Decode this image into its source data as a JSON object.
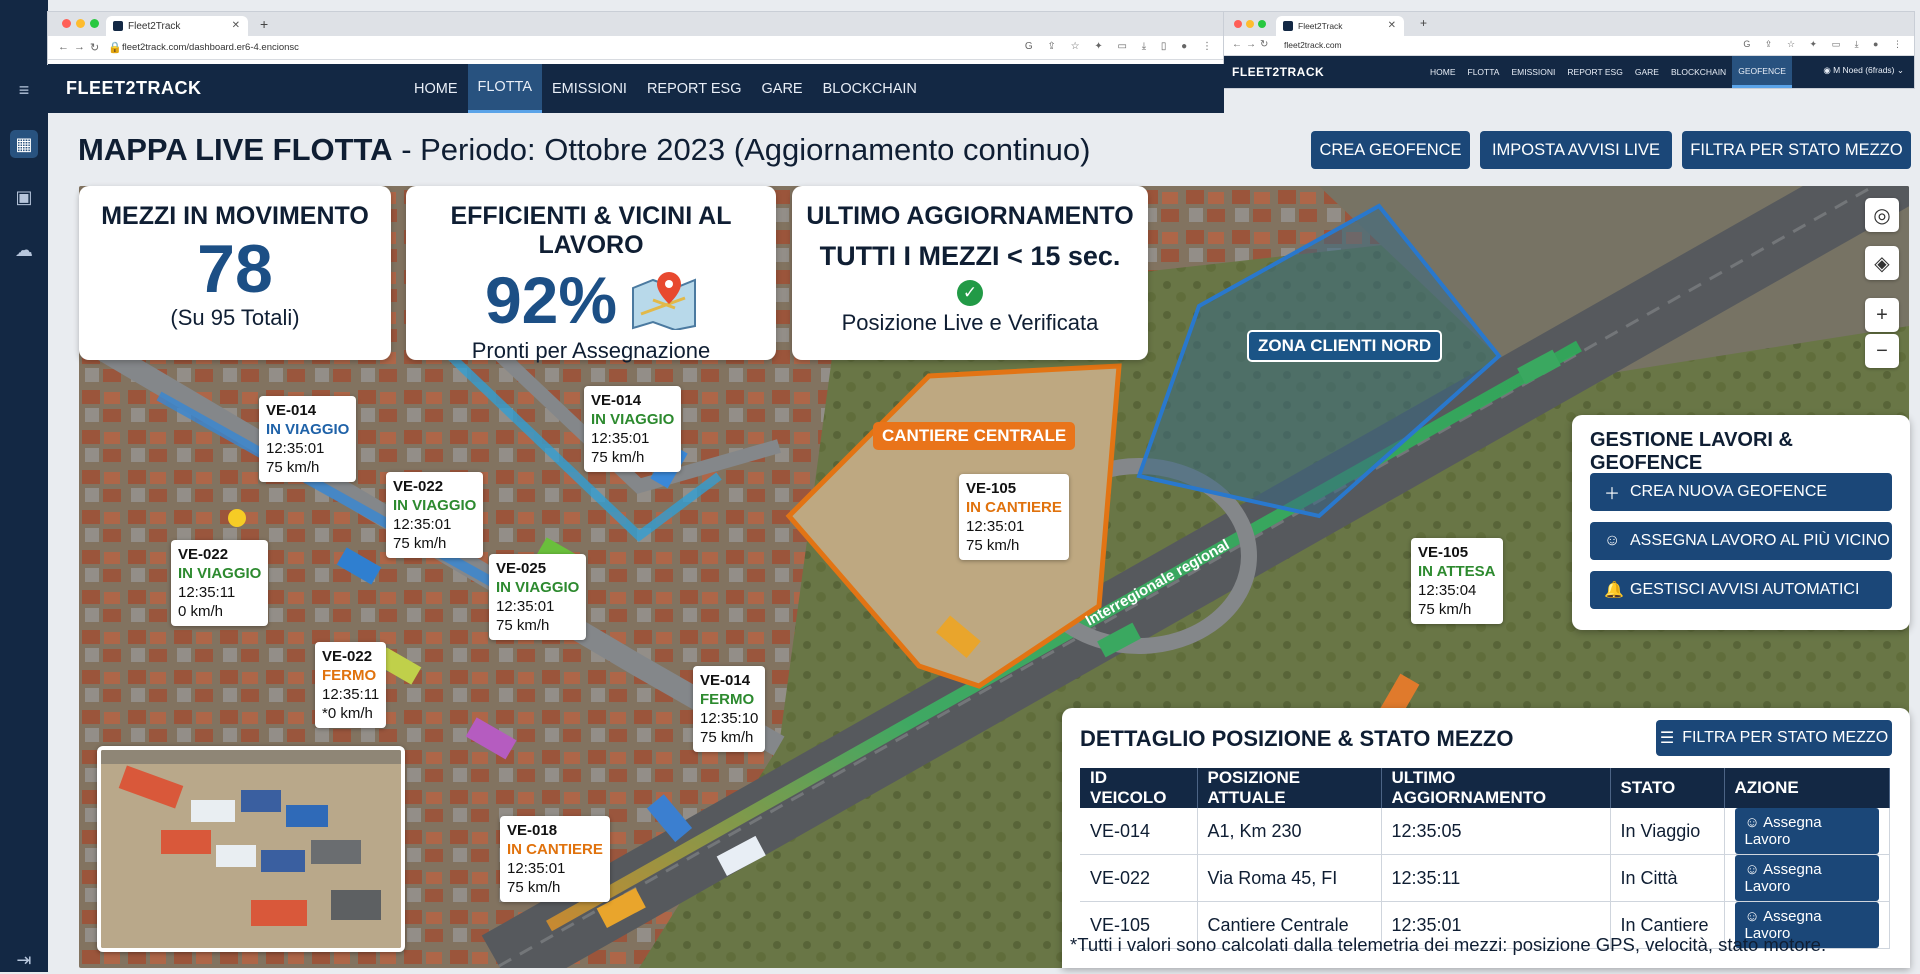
{
  "browser_main": {
    "tab_title": "Fleet2Track",
    "url": "fleet2track.com/dashboard.er6-4.encionsc"
  },
  "browser_secondary": {
    "tab_title": "Fleet2Track",
    "url": "fleet2track.com",
    "brand": "FLEET2TRACK",
    "menu": [
      "HOME",
      "FLOTTA",
      "EMISSIONI",
      "REPORT ESG",
      "GARE",
      "BLOCKCHAIN",
      "GEOFENCE"
    ],
    "active": "GEOFENCE",
    "user": "M Noed (6frads)"
  },
  "app": {
    "brand": "FLEET2TRACK",
    "menu": [
      "HOME",
      "FLOTTA",
      "EMISSIONI",
      "REPORT ESG",
      "GARE",
      "BLOCKCHAIN"
    ],
    "active": "FLOTTA"
  },
  "page": {
    "title_bold": "MAPPA LIVE FLOTTA",
    "title_rest": " - Periodo: Ottobre 2023 (Aggiornamento continuo)",
    "buttons": [
      "CREA GEOFENCE",
      "IMPOSTA AVVISI LIVE",
      "FILTRA PER STATO MEZZO"
    ]
  },
  "kpis": [
    {
      "title": "MEZZI IN MOVIMENTO",
      "value": "78",
      "sub": "(Su 95 Totali)"
    },
    {
      "title": "EFFICIENTI & VICINI AL LAVORO",
      "value": "92%",
      "sub": "Pronti per Assegnazione",
      "icon": "map-pin-icon"
    },
    {
      "title": "ULTIMO AGGIORNAMENTO",
      "value": "TUTTI I MEZZI < 15 sec.",
      "sub": "Posizione Live e Verificata",
      "icon": "check-circle-icon"
    }
  ],
  "map": {
    "zone_labels": [
      "CANTIERE CENTRALE",
      "ZONA CLIENTI NORD"
    ],
    "road_label": "Interregionale regional",
    "vehicles": [
      {
        "id": "VE-014",
        "status": "IN VIAGGIO",
        "time": "12:35:01",
        "speed": "75 km/h",
        "color": "#1f62a8"
      },
      {
        "id": "VE-014",
        "status": "IN VIAGGIO",
        "time": "12:35:01",
        "speed": "75 km/h",
        "color": "#2d8a2f"
      },
      {
        "id": "VE-022",
        "status": "IN VIAGGIO",
        "time": "12:35:01",
        "speed": "75 km/h",
        "color": "#2d8a2f"
      },
      {
        "id": "VE-022",
        "status": "IN VIAGGIO",
        "time": "12:35:11",
        "speed": "0 km/h",
        "color": "#2d8a2f"
      },
      {
        "id": "VE-025",
        "status": "IN VIAGGIO",
        "time": "12:35:01",
        "speed": "75 km/h",
        "color": "#2d8a2f"
      },
      {
        "id": "VE-105",
        "status": "IN CANTIERE",
        "time": "12:35:01",
        "speed": "75 km/h",
        "color": "#e0720d"
      },
      {
        "id": "VE-022",
        "status": "FERMO",
        "time": "12:35:11",
        "speed": "*0 km/h",
        "color": "#e0720d"
      },
      {
        "id": "VE-014",
        "status": "FERMO",
        "time": "12:35:10",
        "speed": "75 km/h",
        "color": "#2d8a2f"
      },
      {
        "id": "VE-105",
        "status": "IN ATTESA",
        "time": "12:35:04",
        "speed": "75 km/h",
        "color": "#2d8a2f"
      },
      {
        "id": "VE-018",
        "status": "IN CANTIERE",
        "time": "12:35:01",
        "speed": "75 km/h",
        "color": "#e0720d"
      }
    ]
  },
  "geofence_panel": {
    "title": "GESTIONE LAVORI & GEOFENCE",
    "buttons": [
      {
        "label": "CREA NUOVA GEOFENCE",
        "icon": "plus-icon"
      },
      {
        "label": "ASSEGNA LAVORO AL PIÙ VICINO",
        "icon": "worker-icon"
      },
      {
        "label": "GESTISCI AVVISI AUTOMATICI",
        "icon": "bell-icon"
      }
    ]
  },
  "detail_panel": {
    "title": "DETTAGLIO POSIZIONE & STATO MEZZO",
    "filter_label": "FILTRA PER STATO MEZZO",
    "columns": [
      "ID VEICOLO",
      "POSIZIONE ATTUALE",
      "ULTIMO AGGIORNAMENTO",
      "STATO",
      "AZIONE"
    ],
    "rows": [
      {
        "id": "VE-014",
        "pos": "A1, Km 230",
        "time": "12:35:05",
        "state": "In Viaggio",
        "action": "Assegna Lavoro"
      },
      {
        "id": "VE-022",
        "pos": "Via Roma 45, FI",
        "time": "12:35:11",
        "state": "In Città",
        "action": "Assegna Lavoro"
      },
      {
        "id": "VE-105",
        "pos": "Cantiere Centrale",
        "time": "12:35:01",
        "state": "In Cantiere",
        "action": "Assegna Lavoro"
      }
    ],
    "footnote": "*Tutti i valori sono calcolati dalla telemetria dei mezzi: posizione GPS, velocità, stato motore."
  }
}
